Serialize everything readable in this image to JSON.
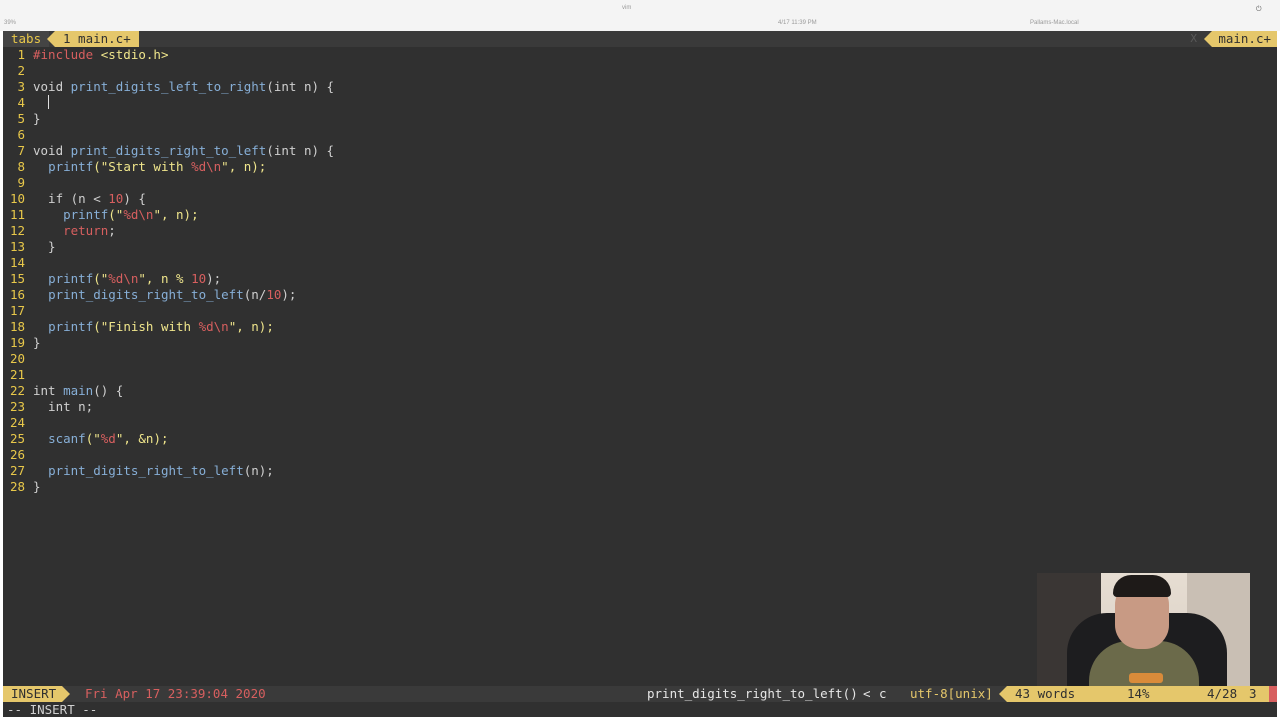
{
  "topbar": {
    "battery": "39%",
    "app_name": "vim",
    "datetime": "4/17 11:39 PM",
    "hostname": "Pallams-Mac.local"
  },
  "tabline": {
    "tabs_label": "tabs",
    "active_tab": "1 main.c+",
    "close_glyph": "X",
    "right_label": "main.c+"
  },
  "code_lines": [
    {
      "n": "1"
    },
    {
      "n": "2"
    },
    {
      "n": "3"
    },
    {
      "n": "4"
    },
    {
      "n": "5"
    },
    {
      "n": "6"
    },
    {
      "n": "7"
    },
    {
      "n": "8"
    },
    {
      "n": "9"
    },
    {
      "n": "10"
    },
    {
      "n": "11"
    },
    {
      "n": "12"
    },
    {
      "n": "13"
    },
    {
      "n": "14"
    },
    {
      "n": "15"
    },
    {
      "n": "16"
    },
    {
      "n": "17"
    },
    {
      "n": "18"
    },
    {
      "n": "19"
    },
    {
      "n": "20"
    },
    {
      "n": "21"
    },
    {
      "n": "22"
    },
    {
      "n": "23"
    },
    {
      "n": "24"
    },
    {
      "n": "25"
    },
    {
      "n": "26"
    },
    {
      "n": "27"
    },
    {
      "n": "28"
    }
  ],
  "code": {
    "l1a": "#include ",
    "l1b": "<stdio.h>",
    "l3a": "void ",
    "l3b": "print_digits_left_to_right",
    "l3c": "(int n) {",
    "l4a": "  ",
    "l5a": "}",
    "l7a": "void ",
    "l7b": "print_digits_right_to_left",
    "l7c": "(int n) {",
    "l8a": "  ",
    "l8b": "printf",
    "l8c": "(\"Start with ",
    "l8d": "%d\\n",
    "l8e": "\", n);",
    "l10a": "  if (n < ",
    "l10b": "10",
    "l10c": ") {",
    "l11a": "    ",
    "l11b": "printf",
    "l11c": "(\"",
    "l11d": "%d\\n",
    "l11e": "\", n);",
    "l12a": "    ",
    "l12b": "return",
    "l12c": ";",
    "l13a": "  }",
    "l15a": "  ",
    "l15b": "printf",
    "l15c": "(\"",
    "l15d": "%d\\n",
    "l15e": "\", n % ",
    "l15f": "10",
    "l15g": ");",
    "l16a": "  ",
    "l16b": "print_digits_right_to_left",
    "l16c": "(n/",
    "l16d": "10",
    "l16e": ");",
    "l18a": "  ",
    "l18b": "printf",
    "l18c": "(\"Finish with ",
    "l18d": "%d\\n",
    "l18e": "\", n);",
    "l19a": "}",
    "l22a": "int ",
    "l22b": "main",
    "l22c": "() {",
    "l23a": "  int n;",
    "l25a": "  ",
    "l25b": "scanf",
    "l25c": "(\"",
    "l25d": "%d",
    "l25e": "\", &n);",
    "l27a": "  ",
    "l27b": "print_digits_right_to_left",
    "l27c": "(n);",
    "l28a": "}"
  },
  "statusline": {
    "mode": "INSERT",
    "datetime": "Fri Apr 17 23:39:04 2020",
    "function": "print_digits_right_to_left()",
    "sep": "<",
    "filetype": "c",
    "encoding": "utf-8[unix]",
    "words": "43 words",
    "percent": "14%",
    "position": "4/28",
    "column": "3"
  },
  "cmdline": {
    "text": "-- INSERT --"
  },
  "colors": {
    "background": "#303030",
    "line_number": "#e8c84a",
    "function": "#87afd7",
    "string": "#f0e68c",
    "keyword_red": "#d75f5f",
    "accent": "#e5c76b"
  }
}
